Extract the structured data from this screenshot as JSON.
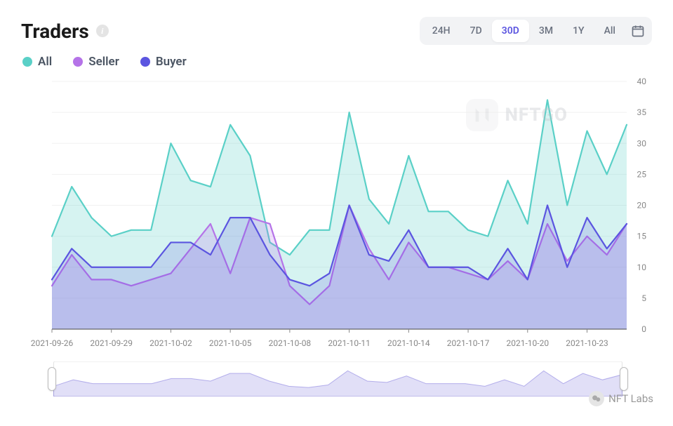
{
  "header": {
    "title": "Traders"
  },
  "ranges": {
    "items": [
      "24H",
      "7D",
      "30D",
      "3M",
      "1Y",
      "All"
    ],
    "active": "30D"
  },
  "legend": [
    {
      "name": "all",
      "label": "All",
      "color": "#5ad0c7"
    },
    {
      "name": "seller",
      "label": "Seller",
      "color": "#b573e8"
    },
    {
      "name": "buyer",
      "label": "Buyer",
      "color": "#5b55e0"
    }
  ],
  "watermark": {
    "text": "NFTGO",
    "icon_letter": "N"
  },
  "footer_badge": {
    "label": "NFT Labs"
  },
  "chart_data": {
    "type": "area",
    "x": [
      "2021-09-26",
      "2021-09-27",
      "2021-09-28",
      "2021-09-29",
      "2021-09-30",
      "2021-10-01",
      "2021-10-02",
      "2021-10-03",
      "2021-10-04",
      "2021-10-05",
      "2021-10-06",
      "2021-10-07",
      "2021-10-08",
      "2021-10-09",
      "2021-10-10",
      "2021-10-11",
      "2021-10-12",
      "2021-10-13",
      "2021-10-14",
      "2021-10-15",
      "2021-10-16",
      "2021-10-17",
      "2021-10-18",
      "2021-10-19",
      "2021-10-20",
      "2021-10-21",
      "2021-10-22",
      "2021-10-23",
      "2021-10-24",
      "2021-10-25"
    ],
    "series": [
      {
        "name": "All",
        "color": "#5ad0c7",
        "fill": "rgba(90,208,199,0.25)",
        "values": [
          15,
          23,
          18,
          15,
          16,
          16,
          30,
          24,
          23,
          33,
          28,
          14,
          12,
          16,
          16,
          35,
          21,
          17,
          28,
          19,
          19,
          16,
          15,
          24,
          17,
          37,
          20,
          32,
          25,
          33
        ]
      },
      {
        "name": "Seller",
        "color": "#b573e8",
        "fill": "rgba(181,115,232,0.22)",
        "values": [
          7,
          12,
          8,
          8,
          7,
          8,
          9,
          13,
          17,
          9,
          18,
          17,
          7,
          4,
          7,
          20,
          13,
          8,
          14,
          10,
          10,
          9,
          8,
          11,
          8,
          17,
          11,
          15,
          12,
          17
        ]
      },
      {
        "name": "Buyer",
        "color": "#5b55e0",
        "fill": "rgba(91,85,224,0.18)",
        "values": [
          8,
          13,
          10,
          10,
          10,
          10,
          14,
          14,
          12,
          18,
          18,
          12,
          8,
          7,
          9,
          20,
          12,
          11,
          16,
          10,
          10,
          10,
          8,
          13,
          8,
          20,
          10,
          18,
          13,
          17
        ]
      }
    ],
    "ylim": [
      0,
      40
    ],
    "yticks": [
      0,
      5,
      10,
      15,
      20,
      25,
      30,
      35,
      40
    ],
    "xticks_shown": [
      "2021-09-26",
      "2021-09-29",
      "2021-10-02",
      "2021-10-05",
      "2021-10-08",
      "2021-10-11",
      "2021-10-14",
      "2021-10-17",
      "2021-10-20",
      "2021-10-23"
    ],
    "xlabel": "",
    "ylabel": "",
    "title": ""
  }
}
